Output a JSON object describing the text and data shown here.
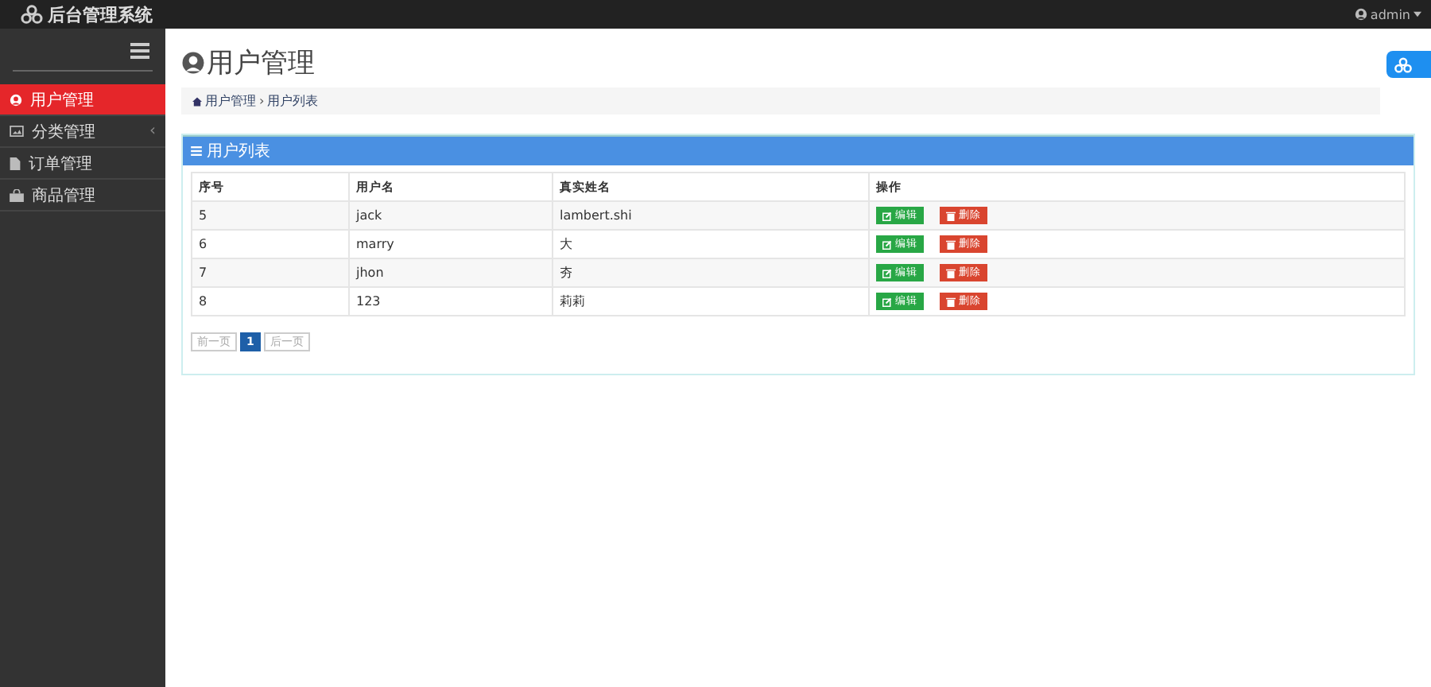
{
  "header": {
    "brand": "后台管理系统",
    "user": "admin"
  },
  "sidebar": {
    "items": [
      {
        "label": "用户管理",
        "kind": "user",
        "selected": true
      },
      {
        "label": "分类管理",
        "kind": "category",
        "selected": false,
        "caret": "‹"
      },
      {
        "label": "订单管理",
        "kind": "order",
        "selected": false
      },
      {
        "label": "商品管理",
        "kind": "product",
        "selected": false
      }
    ]
  },
  "page": {
    "title": "用户管理",
    "breadcrumb": [
      "用户管理",
      "用户列表"
    ],
    "separator": "›"
  },
  "panel": {
    "title": "用户列表",
    "table": {
      "columns": [
        "序号",
        "用户名",
        "真实姓名",
        "操作"
      ],
      "rows": [
        {
          "cells": [
            "5",
            "jack",
            "lambert.shi"
          ],
          "actions": [
            {
              "label": "编辑",
              "kind": "edit"
            },
            {
              "label": "删除",
              "kind": "delete"
            }
          ]
        },
        {
          "cells": [
            "6",
            "marry",
            "大"
          ],
          "actions": [
            {
              "label": "编辑",
              "kind": "edit"
            },
            {
              "label": "删除",
              "kind": "delete"
            }
          ]
        },
        {
          "cells": [
            "7",
            "jhon",
            "夯"
          ],
          "actions": [
            {
              "label": "编辑",
              "kind": "edit"
            },
            {
              "label": "删除",
              "kind": "delete"
            }
          ]
        },
        {
          "cells": [
            "8",
            "123",
            "莉莉"
          ],
          "actions": [
            {
              "label": "编辑",
              "kind": "edit"
            },
            {
              "label": "删除",
              "kind": "delete"
            }
          ]
        }
      ]
    },
    "pagination": [
      {
        "label": "前一页",
        "selected": false,
        "disabled": true
      },
      {
        "label": "1",
        "selected": true,
        "disabled": false
      },
      {
        "label": "后一页",
        "selected": false,
        "disabled": true
      }
    ]
  }
}
